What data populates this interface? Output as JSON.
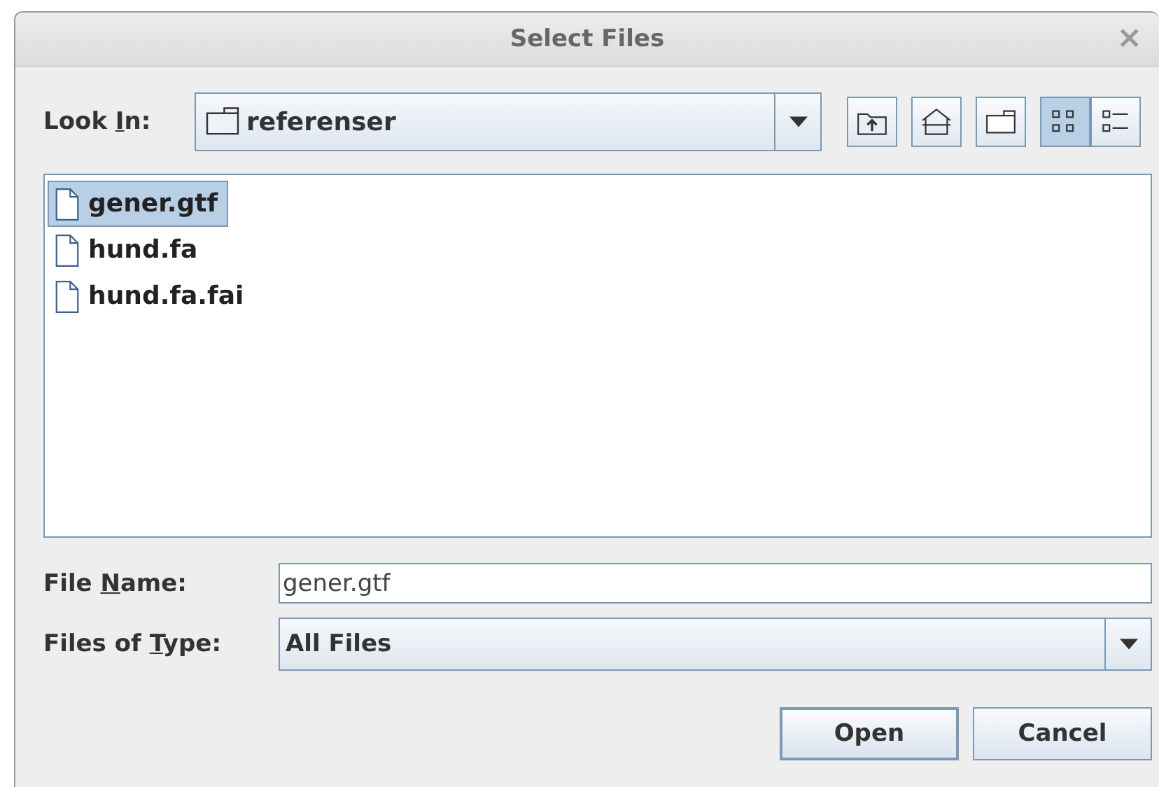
{
  "window": {
    "title": "Select Files",
    "close": "×"
  },
  "look_in": {
    "label_before": "Look ",
    "mnemonic": "I",
    "label_after": "n:",
    "value": "referenser"
  },
  "toolbar": [
    {
      "kind": "up",
      "selected": false
    },
    {
      "kind": "home",
      "selected": false
    },
    {
      "kind": "new-folder",
      "selected": false
    },
    {
      "kind": "list-view",
      "selected": true
    },
    {
      "kind": "details-view",
      "selected": false
    }
  ],
  "files": [
    {
      "name": "gener.gtf",
      "selected": true
    },
    {
      "name": "hund.fa",
      "selected": false
    },
    {
      "name": "hund.fa.fai",
      "selected": false
    }
  ],
  "file_name": {
    "label_before": "File ",
    "mnemonic": "N",
    "label_after": "ame:",
    "value": "gener.gtf"
  },
  "file_type": {
    "label_before": "Files of ",
    "mnemonic": "T",
    "label_after": "ype:",
    "value": "All Files"
  },
  "buttons": [
    "Open",
    "Cancel"
  ]
}
